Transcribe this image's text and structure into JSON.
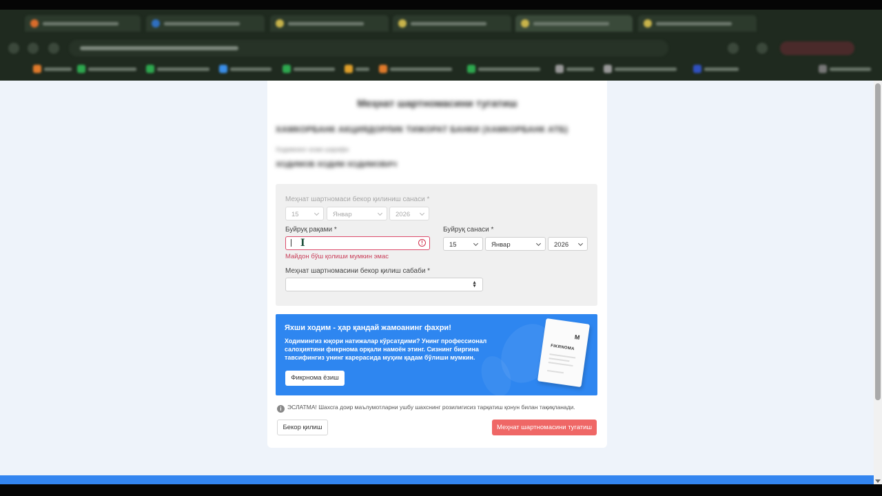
{
  "colors": {
    "primary_blue": "#2e86f0",
    "danger": "#ef6766",
    "error": "#c93f5a",
    "form_bg": "#f0f0f0",
    "page_bg": "#eef3fa"
  },
  "browser": {
    "tab_icon_colors": [
      "#d96b2b",
      "#2f6fbf",
      "#c7b34a",
      "#c7b34a",
      "#c7b34a",
      "#c7b34a"
    ],
    "bookmark_icon_colors": [
      "#e07a2b",
      "#2ea84f",
      "#2ea84f",
      "#3a8ee8",
      "#2ea84f",
      "#e0a02b",
      "#e07a2b",
      "#2ea84f",
      "#999999",
      "#999999",
      "#3050c0"
    ]
  },
  "form": {
    "title": "Меҳнат шартномасини тугатиш",
    "company": "ХАМКОРБАНК АКЦИЯДОРЛИК ТИЖОРАТ БАНКИ (ХАМКОРБАНК АТБ)",
    "employee_label": "Ходимнинг исми шарифи",
    "employee_name": "ХОДИМОВ ХОДИМ ХОДИМОВИЧ",
    "termination_date": {
      "label": "Меҳнат шартномаси бекор қилиниш санаси *",
      "day": "15",
      "month": "Январ",
      "year": "2026"
    },
    "order_number": {
      "label": "Буйруқ рақами *",
      "value": "",
      "error": "Майдон бўш қолиши мумкин эмас",
      "error_icon": "alert-circle-icon"
    },
    "order_date": {
      "label": "Буйруқ санаси *",
      "day": "15",
      "month": "Январ",
      "year": "2026"
    },
    "reason": {
      "label": "Меҳнат шартномасини бекор қилиш сабаби *",
      "value": ""
    }
  },
  "banner": {
    "title": "Яхши ходим - ҳар қандай жамоанинг фахри!",
    "text": "Ходимингиз юқори натижалар кўрсатдими? Унинг профессионал салоҳиятини фикрнома орқали намоён этинг. Сизнинг биргина тавсифингиз унинг карерасида муҳим қадам бўлиши мумкин.",
    "button": "Фикрнома ёзиш",
    "doc_logo": "M",
    "doc_title": "FIKRNOMA"
  },
  "notice": {
    "icon": "info-icon",
    "text": "ЭСЛАТМА! Шахсга доир маълумотларни ушбу шахснинг розилигисиз тарқатиш қонун билан тақиқланади."
  },
  "actions": {
    "cancel": "Бекор қилиш",
    "terminate": "Меҳнат шартномасини тугатиш"
  }
}
